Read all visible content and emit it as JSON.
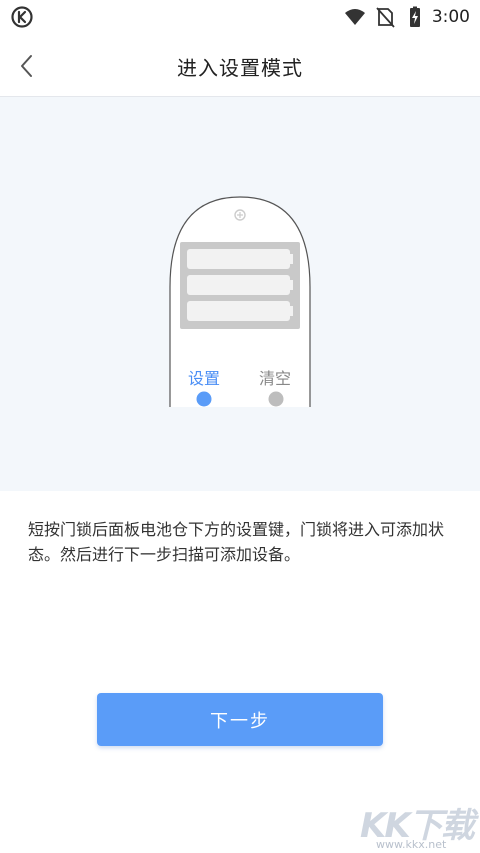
{
  "status_bar": {
    "time": "3:00",
    "icons": [
      "app-logo-icon",
      "wifi-icon",
      "no-sim-icon",
      "battery-charging-icon"
    ]
  },
  "header": {
    "back_icon": "chevron-left-icon",
    "title": "进入设置模式"
  },
  "illustration": {
    "label_setup": "设置",
    "label_clear": "清空",
    "colors": {
      "background": "#f3f7fb",
      "battery": "#c9c9c9",
      "setup_dot": "#5a9cf8",
      "clear_dot": "#bdbdbd"
    }
  },
  "instruction": {
    "text": "短按门锁后面板电池仓下方的设置键，门锁将进入可添加状态。然后进行下一步扫描可添加设备。"
  },
  "actions": {
    "next_label": "下一步",
    "accent_color": "#5a9cf8"
  },
  "watermark": {
    "brand": "KK下载",
    "url": "www.kkx.net"
  }
}
